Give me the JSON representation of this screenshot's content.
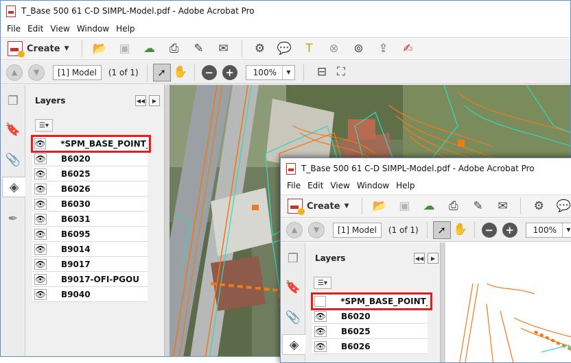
{
  "window_title": "T_Base 500 61 C-D SIMPL-Model.pdf - Adobe Acrobat Pro",
  "menu": [
    "File",
    "Edit",
    "View",
    "Window",
    "Help"
  ],
  "toolbar": {
    "create_label": "Create",
    "page_value": "[1] Model",
    "page_of": "(1 of 1)",
    "zoom_value": "100%"
  },
  "layers_panel": {
    "title": "Layers",
    "collapse_glyph": "◀◀",
    "options_glyph": "▶",
    "layers": [
      {
        "name": "*SPM_BASE_POINT_LA",
        "visible": true
      },
      {
        "name": "B6020",
        "visible": true
      },
      {
        "name": "B6025",
        "visible": true
      },
      {
        "name": "B6026",
        "visible": true
      },
      {
        "name": "B6030",
        "visible": true
      },
      {
        "name": "B6031",
        "visible": true
      },
      {
        "name": "B6095",
        "visible": true
      },
      {
        "name": "B9014",
        "visible": true
      },
      {
        "name": "B9017",
        "visible": true
      },
      {
        "name": "B9017-OFI-PGOU",
        "visible": true
      },
      {
        "name": "B9040",
        "visible": true
      }
    ]
  },
  "front_window": {
    "layers": [
      {
        "name": "*SPM_BASE_POINT_LA",
        "visible": false
      },
      {
        "name": "B6020",
        "visible": true
      },
      {
        "name": "B6025",
        "visible": true
      },
      {
        "name": "B6026",
        "visible": true
      }
    ]
  },
  "icons": {
    "eye": "👁",
    "hand": "✋",
    "pointer": "➚"
  },
  "colors": {
    "highlight": "#e41d1d",
    "contour_orange": "#f07a1a",
    "contour_cyan": "#35d6c0"
  }
}
